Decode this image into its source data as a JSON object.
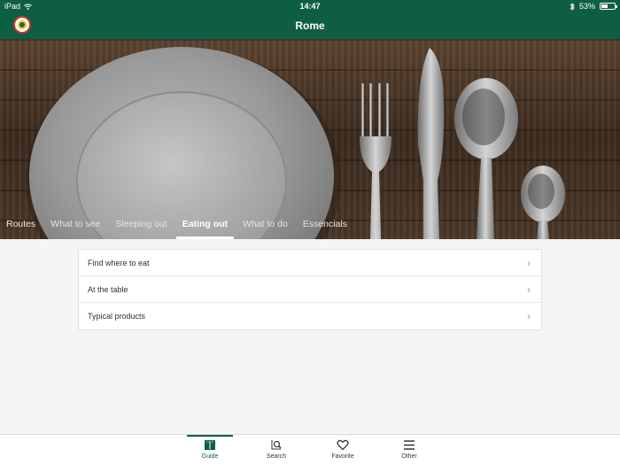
{
  "status": {
    "device": "iPad",
    "time": "14:47",
    "battery": "53%",
    "battery_level": 0.53
  },
  "header": {
    "title": "Rome"
  },
  "tabs": [
    {
      "label": "Routes"
    },
    {
      "label": "What to see"
    },
    {
      "label": "Sleeping out"
    },
    {
      "label": "Eating out"
    },
    {
      "label": "What to do"
    },
    {
      "label": "Essencials"
    }
  ],
  "active_tab": "Eating out",
  "list": [
    {
      "label": "Find where to eat"
    },
    {
      "label": "At the table"
    },
    {
      "label": "Typical products"
    }
  ],
  "bottom_nav": [
    {
      "label": "Guide",
      "icon": "book-icon"
    },
    {
      "label": "Search",
      "icon": "search-icon"
    },
    {
      "label": "Favorite",
      "icon": "heart-icon"
    },
    {
      "label": "Other",
      "icon": "menu-icon"
    }
  ],
  "colors": {
    "brand": "#0e5e45"
  }
}
